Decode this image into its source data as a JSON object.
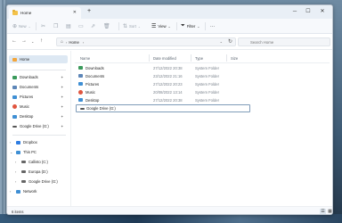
{
  "window": {
    "tab_title": "Home",
    "new_tab": "+",
    "minimize": "─",
    "maximize": "☐",
    "close": "✕"
  },
  "toolbar": {
    "new_label": "New",
    "sort_label": "Sort",
    "view_label": "View",
    "filter_label": "Filter",
    "more_label": "···"
  },
  "address": {
    "crumb": "Home",
    "search_placeholder": "Search Home"
  },
  "sidebar": {
    "home": "Home",
    "quick": [
      {
        "label": "Downloads",
        "icon": "download-folder-icon",
        "color": "#3a9a5b"
      },
      {
        "label": "Documents",
        "icon": "documents-folder-icon",
        "color": "#5d86b8"
      },
      {
        "label": "Pictures",
        "icon": "pictures-folder-icon",
        "color": "#3f8fd4"
      },
      {
        "label": "Music",
        "icon": "music-folder-icon",
        "color": "#e0553f"
      },
      {
        "label": "Desktop",
        "icon": "desktop-folder-icon",
        "color": "#3f8fd4"
      },
      {
        "label": "Google Drive (G:)",
        "icon": "drive-icon",
        "color": "#555555"
      }
    ],
    "dropbox": "Dropbox",
    "this_pc": "This PC",
    "drives": [
      {
        "label": "Callisto (C:)"
      },
      {
        "label": "Europa (D:)"
      },
      {
        "label": "Google Drive (G:)"
      }
    ],
    "network": "Network"
  },
  "columns": {
    "name": "Name",
    "date": "Date modified",
    "type": "Type",
    "size": "Size"
  },
  "files": [
    {
      "name": "Downloads",
      "date": "27/12/2022 20:38",
      "type": "System Folder",
      "color": "#3a9a5b"
    },
    {
      "name": "Documents",
      "date": "23/12/2022 21:16",
      "type": "System Folder",
      "color": "#5d86b8"
    },
    {
      "name": "Pictures",
      "date": "27/12/2022 20:23",
      "type": "System Folder",
      "color": "#3f8fd4"
    },
    {
      "name": "Music",
      "date": "20/08/2022 13:14",
      "type": "System Folder",
      "color": "#e0553f"
    },
    {
      "name": "Desktop",
      "date": "27/12/2022 20:38",
      "type": "System Folder",
      "color": "#3f8fd4"
    },
    {
      "name": "Google Drive (G:)",
      "date": "",
      "type": "",
      "color": "#555555"
    }
  ],
  "status": {
    "items_count": "6 items"
  }
}
